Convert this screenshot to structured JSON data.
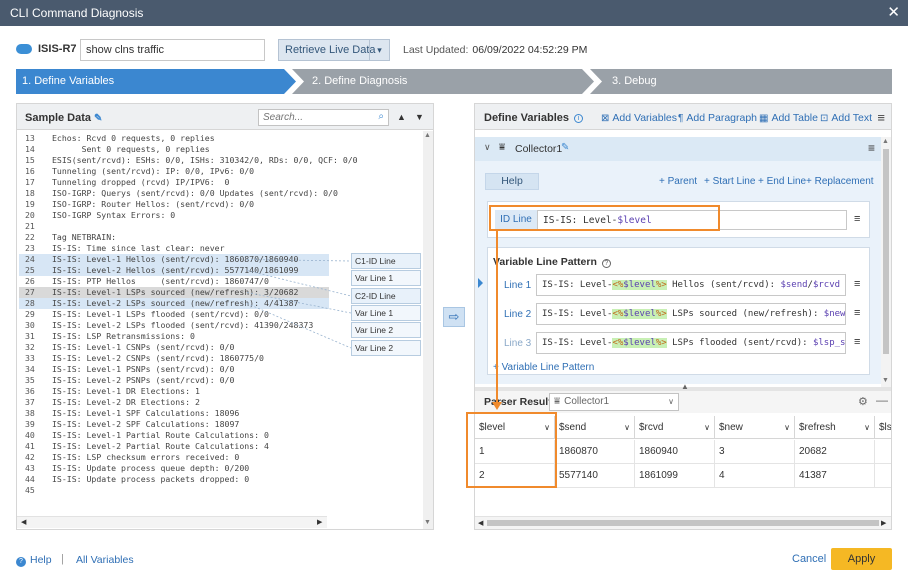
{
  "window": {
    "title": "CLI Command Diagnosis",
    "close": "✕"
  },
  "toolbar": {
    "device_name": "ISIS-R7",
    "command_value": "show clns traffic",
    "retrieve_label": "Retrieve Live Data",
    "last_updated_label": "Last Updated:",
    "last_updated_value": "06/09/2022 04:52:29 PM"
  },
  "steps": [
    {
      "label": "1. Define Variables"
    },
    {
      "label": "2. Define Diagnosis"
    },
    {
      "label": "3. Debug"
    }
  ],
  "sample": {
    "title": "Sample Data",
    "search_placeholder": "Search...",
    "lines": [
      {
        "n": "13",
        "t": "Echos: Rcvd 0 requests, 0 replies"
      },
      {
        "n": "14",
        "t": "      Sent 0 requests, 0 replies"
      },
      {
        "n": "15",
        "t": "ESIS(sent/rcvd): ESHs: 0/0, ISHs: 310342/0, RDs: 0/0, QCF: 0/0"
      },
      {
        "n": "16",
        "t": "Tunneling (sent/rcvd): IP: 0/0, IPv6: 0/0"
      },
      {
        "n": "17",
        "t": "Tunneling dropped (rcvd) IP/IPV6:  0"
      },
      {
        "n": "18",
        "t": "ISO-IGRP: Querys (sent/rcvd): 0/0 Updates (sent/rcvd): 0/0"
      },
      {
        "n": "19",
        "t": "ISO-IGRP: Router Hellos: (sent/rcvd): 0/0"
      },
      {
        "n": "20",
        "t": "ISO-IGRP Syntax Errors: 0"
      },
      {
        "n": "21",
        "t": ""
      },
      {
        "n": "22",
        "t": "Tag NETBRAIN:"
      },
      {
        "n": "23",
        "t": "IS-IS: Time since last clear: never"
      },
      {
        "n": "24",
        "t": "IS-IS: Level-1 Hellos (sent/rcvd): 1860870/1860940"
      },
      {
        "n": "25",
        "t": "IS-IS: Level-2 Hellos (sent/rcvd): 5577140/1861099"
      },
      {
        "n": "26",
        "t": "IS-IS: PTP Hellos     (sent/rcvd): 1860747/0"
      },
      {
        "n": "27",
        "t": "IS-IS: Level-1 LSPs sourced (new/refresh): 3/20682"
      },
      {
        "n": "28",
        "t": "IS-IS: Level-2 LSPs sourced (new/refresh): 4/41387"
      },
      {
        "n": "29",
        "t": "IS-IS: Level-1 LSPs flooded (sent/rcvd): 0/0"
      },
      {
        "n": "30",
        "t": "IS-IS: Level-2 LSPs flooded (sent/rcvd): 41390/248373"
      },
      {
        "n": "31",
        "t": "IS-IS: LSP Retransmissions: 0"
      },
      {
        "n": "32",
        "t": "IS-IS: Level-1 CSNPs (sent/rcvd): 0/0"
      },
      {
        "n": "33",
        "t": "IS-IS: Level-2 CSNPs (sent/rcvd): 1860775/0"
      },
      {
        "n": "34",
        "t": "IS-IS: Level-1 PSNPs (sent/rcvd): 0/0"
      },
      {
        "n": "35",
        "t": "IS-IS: Level-2 PSNPs (sent/rcvd): 0/0"
      },
      {
        "n": "36",
        "t": "IS-IS: Level-1 DR Elections: 1"
      },
      {
        "n": "37",
        "t": "IS-IS: Level-2 DR Elections: 2"
      },
      {
        "n": "38",
        "t": "IS-IS: Level-1 SPF Calculations: 18096"
      },
      {
        "n": "39",
        "t": "IS-IS: Level-2 SPF Calculations: 18097"
      },
      {
        "n": "40",
        "t": "IS-IS: Level-1 Partial Route Calculations: 0"
      },
      {
        "n": "41",
        "t": "IS-IS: Level-2 Partial Route Calculations: 4"
      },
      {
        "n": "42",
        "t": "IS-IS: LSP checksum errors received: 0"
      },
      {
        "n": "43",
        "t": "IS-IS: Update process queue depth: 0/200"
      },
      {
        "n": "44",
        "t": "IS-IS: Update process packets dropped: 0"
      },
      {
        "n": "45",
        "t": ""
      }
    ],
    "var_boxes": [
      "C1-ID Line",
      "Var Line 1",
      "C2-ID Line",
      "Var Line 1",
      "Var Line 2",
      "Var Line 2"
    ]
  },
  "define": {
    "title": "Define Variables",
    "add_variables": "Add Variables",
    "add_paragraph": "Add Paragraph",
    "add_table": "Add Table",
    "add_text": "Add Text",
    "collector_name": "Collector1",
    "help": "Help",
    "parent": "+ Parent",
    "start_line": "+ Start Line",
    "end_line": "+ End Line",
    "replacement": "+ Replacement",
    "id_line_label": "ID Line",
    "id_line_prefix": "IS-IS: Level-",
    "id_line_var": "$level",
    "vlp_title": "Variable Line Pattern",
    "lines": [
      {
        "label": "Line 1",
        "pre": "IS-IS: Level-",
        "open": "<%",
        "var": "$level",
        "close": "%>",
        "post": " Hellos (sent/rcvd): ",
        "v2": "$send",
        "sep": "/",
        "v3": "$rcvd"
      },
      {
        "label": "Line 2",
        "pre": "IS-IS: Level-",
        "open": "<%",
        "var": "$level",
        "close": "%>",
        "post": " LSPs sourced (new/refresh): ",
        "v2": "$new",
        "sep": "/",
        "v3": "$"
      },
      {
        "label": "Line 3",
        "pre": "IS-IS: Level-",
        "open": "<%",
        "var": "$level",
        "close": "%>",
        "post": " LSPs flooded (sent/rcvd): ",
        "v2": "$lsp_se",
        "sep": "",
        "v3": ""
      }
    ],
    "add_vlp": "+ Variable Line Pattern"
  },
  "parser": {
    "title": "Parser Result",
    "collector": "Collector1",
    "columns": [
      "$level",
      "$send",
      "$rcvd",
      "$new",
      "$refresh",
      "$ls"
    ],
    "rows": [
      [
        "1",
        "1860870",
        "1860940",
        "3",
        "20682",
        ""
      ],
      [
        "2",
        "5577140",
        "1861099",
        "4",
        "41387",
        ""
      ]
    ]
  },
  "footer": {
    "help": "Help",
    "separator": "|",
    "all_variables": "All Variables",
    "cancel": "Cancel",
    "apply": "Apply"
  },
  "colors": {
    "accent": "#3b87d0",
    "title_bar": "#4a5a6e",
    "highlight_orange": "#f08a2c",
    "apply": "#f5b824"
  }
}
